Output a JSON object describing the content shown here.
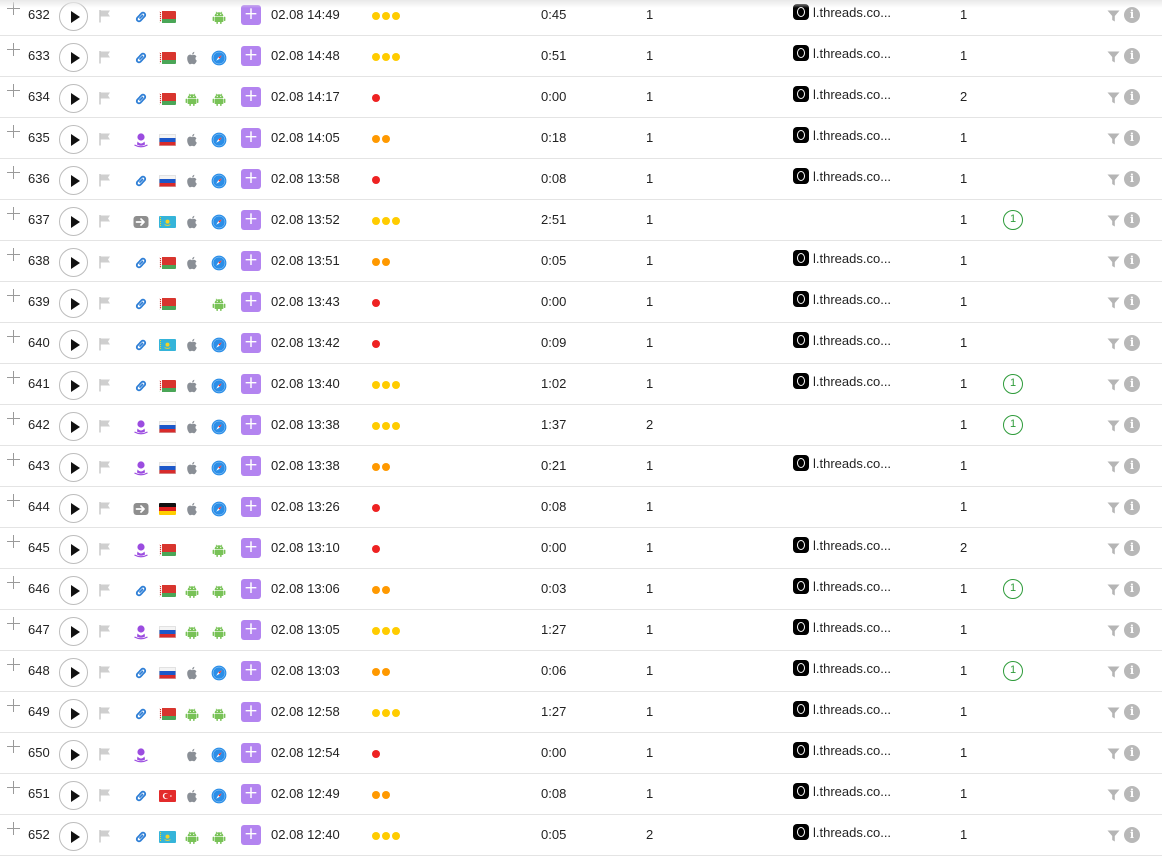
{
  "colors": {
    "accent_purple": "#b384f0",
    "dot_yellow": "#ffcc00",
    "dot_orange": "#ff9900",
    "dot_red": "#ee2222",
    "goal_green": "#2e9b3a"
  },
  "icons": {
    "expand": "plus-icon",
    "play": "play-icon",
    "flag": "flag-icon",
    "link": "link-icon",
    "ad": "ad-person-icon",
    "direct": "direct-entry-icon",
    "apple": "apple-icon",
    "android": "android-icon",
    "safari": "safari-icon",
    "threads": "threads-icon",
    "filter": "filter-icon",
    "info": "info-icon"
  },
  "add_label": "+",
  "info_label": "i",
  "rows": [
    {
      "num": "632",
      "src": "link",
      "country": "by",
      "os": "",
      "browser": "android",
      "time": "02.08 14:49",
      "dots": 3,
      "dur": "0:45",
      "pages": "1",
      "ref": "l.threads.co...",
      "visits": "1",
      "goal": ""
    },
    {
      "num": "633",
      "src": "link",
      "country": "by",
      "os": "apple",
      "browser": "safari",
      "time": "02.08 14:48",
      "dots": 3,
      "dur": "0:51",
      "pages": "1",
      "ref": "l.threads.co...",
      "visits": "1",
      "goal": ""
    },
    {
      "num": "634",
      "src": "link",
      "country": "by",
      "os": "android",
      "browser": "android",
      "time": "02.08 14:17",
      "dots": 1,
      "dur": "0:00",
      "pages": "1",
      "ref": "l.threads.co...",
      "visits": "2",
      "goal": ""
    },
    {
      "num": "635",
      "src": "ad",
      "country": "ru",
      "os": "apple",
      "browser": "safari",
      "time": "02.08 14:05",
      "dots": 2,
      "dur": "0:18",
      "pages": "1",
      "ref": "l.threads.co...",
      "visits": "1",
      "goal": ""
    },
    {
      "num": "636",
      "src": "link",
      "country": "ru",
      "os": "apple",
      "browser": "safari",
      "time": "02.08 13:58",
      "dots": 1,
      "dur": "0:08",
      "pages": "1",
      "ref": "l.threads.co...",
      "visits": "1",
      "goal": ""
    },
    {
      "num": "637",
      "src": "direct",
      "country": "kz",
      "os": "apple",
      "browser": "safari",
      "time": "02.08 13:52",
      "dots": 3,
      "dur": "2:51",
      "pages": "1",
      "ref": "",
      "visits": "1",
      "goal": "1"
    },
    {
      "num": "638",
      "src": "link",
      "country": "by",
      "os": "apple",
      "browser": "safari",
      "time": "02.08 13:51",
      "dots": 2,
      "dur": "0:05",
      "pages": "1",
      "ref": "l.threads.co...",
      "visits": "1",
      "goal": ""
    },
    {
      "num": "639",
      "src": "link",
      "country": "by",
      "os": "",
      "browser": "android",
      "time": "02.08 13:43",
      "dots": 1,
      "dur": "0:00",
      "pages": "1",
      "ref": "l.threads.co...",
      "visits": "1",
      "goal": ""
    },
    {
      "num": "640",
      "src": "link",
      "country": "kz",
      "os": "apple",
      "browser": "safari",
      "time": "02.08 13:42",
      "dots": 1,
      "dur": "0:09",
      "pages": "1",
      "ref": "l.threads.co...",
      "visits": "1",
      "goal": ""
    },
    {
      "num": "641",
      "src": "link",
      "country": "by",
      "os": "apple",
      "browser": "safari",
      "time": "02.08 13:40",
      "dots": 3,
      "dur": "1:02",
      "pages": "1",
      "ref": "l.threads.co...",
      "visits": "1",
      "goal": "1"
    },
    {
      "num": "642",
      "src": "ad",
      "country": "ru",
      "os": "apple",
      "browser": "safari",
      "time": "02.08 13:38",
      "dots": 3,
      "dur": "1:37",
      "pages": "2",
      "ref": "",
      "visits": "1",
      "goal": "1"
    },
    {
      "num": "643",
      "src": "ad",
      "country": "ru",
      "os": "apple",
      "browser": "safari",
      "time": "02.08 13:38",
      "dots": 2,
      "dur": "0:21",
      "pages": "1",
      "ref": "l.threads.co...",
      "visits": "1",
      "goal": ""
    },
    {
      "num": "644",
      "src": "direct",
      "country": "de",
      "os": "apple",
      "browser": "safari",
      "time": "02.08 13:26",
      "dots": 1,
      "dur": "0:08",
      "pages": "1",
      "ref": "",
      "visits": "1",
      "goal": ""
    },
    {
      "num": "645",
      "src": "ad",
      "country": "by",
      "os": "",
      "browser": "android",
      "time": "02.08 13:10",
      "dots": 1,
      "dur": "0:00",
      "pages": "1",
      "ref": "l.threads.co...",
      "visits": "2",
      "goal": ""
    },
    {
      "num": "646",
      "src": "link",
      "country": "by",
      "os": "android",
      "browser": "android",
      "time": "02.08 13:06",
      "dots": 2,
      "dur": "0:03",
      "pages": "1",
      "ref": "l.threads.co...",
      "visits": "1",
      "goal": "1"
    },
    {
      "num": "647",
      "src": "ad",
      "country": "ru",
      "os": "android",
      "browser": "android",
      "time": "02.08 13:05",
      "dots": 3,
      "dur": "1:27",
      "pages": "1",
      "ref": "l.threads.co...",
      "visits": "1",
      "goal": ""
    },
    {
      "num": "648",
      "src": "link",
      "country": "ru",
      "os": "apple",
      "browser": "safari",
      "time": "02.08 13:03",
      "dots": 2,
      "dur": "0:06",
      "pages": "1",
      "ref": "l.threads.co...",
      "visits": "1",
      "goal": "1"
    },
    {
      "num": "649",
      "src": "link",
      "country": "by",
      "os": "android",
      "browser": "android",
      "time": "02.08 12:58",
      "dots": 3,
      "dur": "1:27",
      "pages": "1",
      "ref": "l.threads.co...",
      "visits": "1",
      "goal": ""
    },
    {
      "num": "650",
      "src": "ad",
      "country": "",
      "os": "apple",
      "browser": "safari",
      "time": "02.08 12:54",
      "dots": 1,
      "dur": "0:00",
      "pages": "1",
      "ref": "l.threads.co...",
      "visits": "1",
      "goal": ""
    },
    {
      "num": "651",
      "src": "link",
      "country": "tr",
      "os": "apple",
      "browser": "safari",
      "time": "02.08 12:49",
      "dots": 2,
      "dur": "0:08",
      "pages": "1",
      "ref": "l.threads.co...",
      "visits": "1",
      "goal": ""
    },
    {
      "num": "652",
      "src": "link",
      "country": "kz",
      "os": "android",
      "browser": "android",
      "time": "02.08 12:40",
      "dots": 3,
      "dur": "0:05",
      "pages": "2",
      "ref": "l.threads.co...",
      "visits": "1",
      "goal": ""
    }
  ]
}
